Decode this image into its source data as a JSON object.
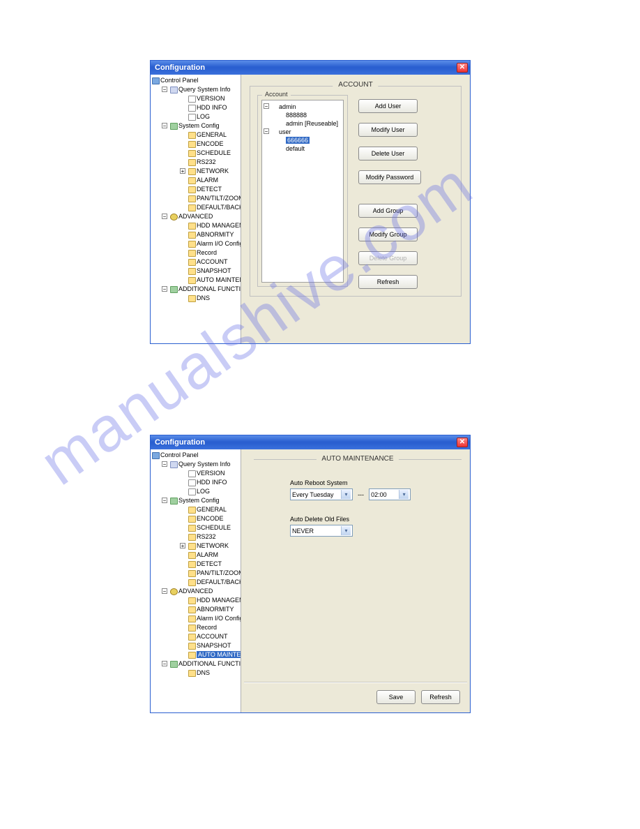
{
  "watermark": "manualshive.com",
  "win1": {
    "title": "Configuration",
    "section_title": "ACCOUNT",
    "account_label": "Account",
    "account_tree": {
      "admin": {
        "name": "admin",
        "children": [
          "888888",
          "admin [Reuseable]"
        ]
      },
      "user": {
        "name": "user",
        "children": [
          "666666",
          "default"
        ]
      },
      "selected": "666666"
    },
    "buttons": {
      "add_user": "Add User",
      "modify_user": "Modify User",
      "delete_user": "Delete User",
      "modify_password": "Modify Password",
      "add_group": "Add Group",
      "modify_group": "Modify Group",
      "delete_group": "Delete Group",
      "refresh": "Refresh"
    }
  },
  "win2": {
    "title": "Configuration",
    "section_title": "AUTO MAINTENANCE",
    "auto_reboot_label": "Auto Reboot System",
    "auto_reboot_day": "Every Tuesday",
    "auto_reboot_time": "02:00",
    "auto_delete_label": "Auto Delete Old Files",
    "auto_delete_value": "NEVER",
    "buttons": {
      "save": "Save",
      "refresh": "Refresh"
    }
  },
  "tree": {
    "root": "Control Panel",
    "query": "Query System Info",
    "version": "VERSION",
    "hdd_info": "HDD INFO",
    "log": "LOG",
    "system_config": "System Config",
    "general": "GENERAL",
    "encode": "ENCODE",
    "schedule": "SCHEDULE",
    "rs232": "RS232",
    "network": "NETWORK",
    "alarm": "ALARM",
    "detect": "DETECT",
    "ptz": "PAN/TILT/ZOOM",
    "default_backup": "DEFAULT/BACKUP",
    "advanced": "ADVANCED",
    "hdd_mgmt": "HDD MANAGEMENT",
    "abnormity": "ABNORMITY",
    "alarm_io": "Alarm I/O Config",
    "record": "Record",
    "account": "ACCOUNT",
    "snapshot": "SNAPSHOT",
    "auto_maint": "AUTO MAINTENANCE",
    "additional": "ADDITIONAL FUNCTION",
    "dns": "DNS"
  }
}
